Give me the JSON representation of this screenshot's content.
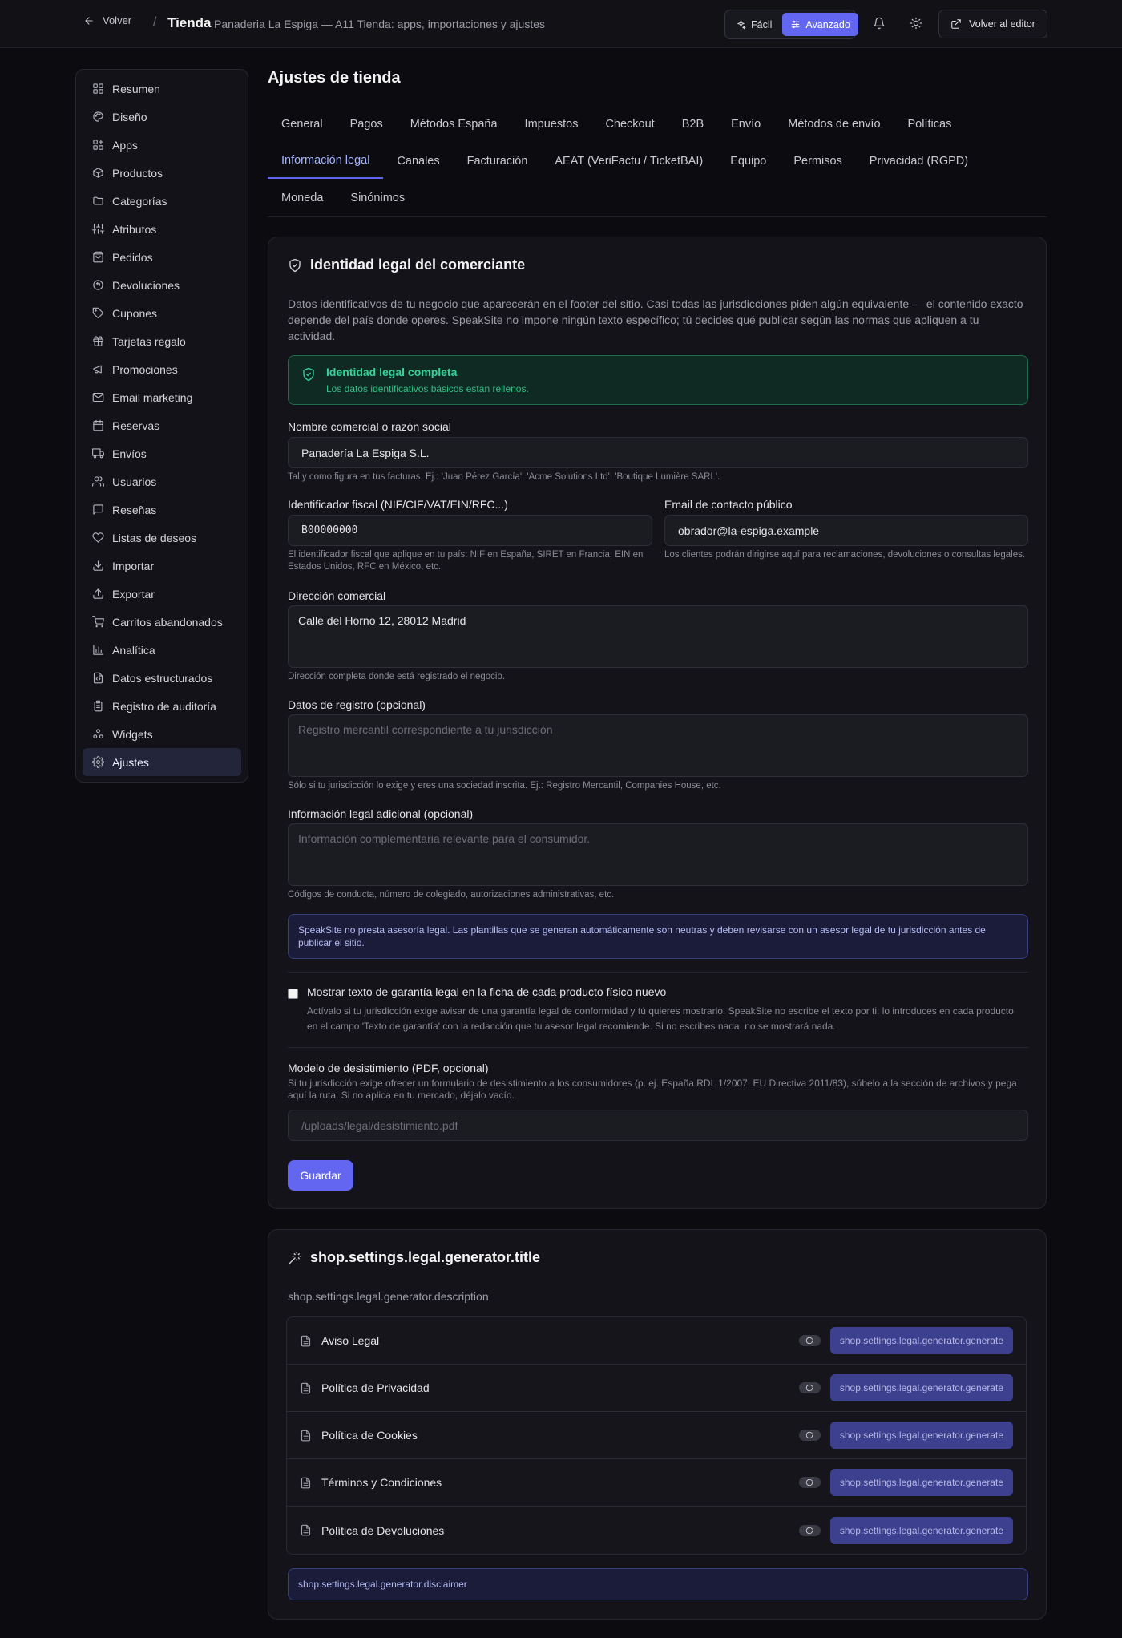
{
  "topbar": {
    "back_label": "Volver",
    "separator": "/",
    "app_title": "Tienda",
    "subtitle": "Panaderia La Espiga — A11 Tienda: apps, importaciones y ajustes",
    "mode_easy": "Fácil",
    "mode_advanced": "Avanzado",
    "editor_label": "Volver al editor",
    "accent_color": "#6366f1"
  },
  "sidebar": {
    "items": [
      {
        "label": "Resumen",
        "icon": "layout-grid-icon"
      },
      {
        "label": "Diseño",
        "icon": "palette-icon"
      },
      {
        "label": "Apps",
        "icon": "apps-icon"
      },
      {
        "label": "Productos",
        "icon": "package-icon"
      },
      {
        "label": "Categorías",
        "icon": "folder-icon"
      },
      {
        "label": "Atributos",
        "icon": "sliders-icon"
      },
      {
        "label": "Pedidos",
        "icon": "shopping-bag-icon"
      },
      {
        "label": "Devoluciones",
        "icon": "return-icon"
      },
      {
        "label": "Cupones",
        "icon": "tag-icon"
      },
      {
        "label": "Tarjetas regalo",
        "icon": "gift-icon"
      },
      {
        "label": "Promociones",
        "icon": "megaphone-icon"
      },
      {
        "label": "Email marketing",
        "icon": "mail-icon"
      },
      {
        "label": "Reservas",
        "icon": "calendar-icon"
      },
      {
        "label": "Envíos",
        "icon": "truck-icon"
      },
      {
        "label": "Usuarios",
        "icon": "users-icon"
      },
      {
        "label": "Reseñas",
        "icon": "message-icon"
      },
      {
        "label": "Listas de deseos",
        "icon": "heart-icon"
      },
      {
        "label": "Importar",
        "icon": "download-icon"
      },
      {
        "label": "Exportar",
        "icon": "upload-icon"
      },
      {
        "label": "Carritos abandonados",
        "icon": "cart-icon"
      },
      {
        "label": "Analítica",
        "icon": "bar-chart-icon"
      },
      {
        "label": "Datos estructurados",
        "icon": "file-code-icon"
      },
      {
        "label": "Registro de auditoría",
        "icon": "clipboard-icon"
      },
      {
        "label": "Widgets",
        "icon": "widgets-icon"
      },
      {
        "label": "Ajustes",
        "icon": "settings-icon"
      }
    ],
    "active": "Ajustes"
  },
  "main": {
    "title": "Ajustes de tienda",
    "tabs_row1": [
      "General",
      "Pagos",
      "Métodos España",
      "Impuestos",
      "Checkout",
      "B2B",
      "Envío",
      "Métodos de envío",
      "Políticas"
    ],
    "tabs_row2": [
      "Información legal",
      "Canales",
      "Facturación",
      "AEAT (VeriFactu / TicketBAI)",
      "Equipo",
      "Permisos",
      "Privacidad (RGPD)"
    ],
    "tabs_row3": [
      "Moneda",
      "Sinónimos"
    ],
    "active_tab": "Información legal"
  },
  "legal": {
    "title": "Identidad legal del comerciante",
    "description": "Datos identificativos de tu negocio que aparecerán en el footer del sitio. Casi todas las jurisdicciones piden algún equivalente — el contenido exacto depende del país donde operes. SpeakSite no impone ningún texto específico; tú decides qué publicar según las normas que apliquen a tu actividad.",
    "status_title": "Identidad legal completa",
    "status_sub": "Los datos identificativos básicos están rellenos.",
    "name_label": "Nombre comercial o razón social",
    "name_value": "Panadería La Espiga S.L.",
    "name_help": "Tal y como figura en tus facturas. Ej.: 'Juan Pérez García', 'Acme Solutions Ltd', 'Boutique Lumière SARL'.",
    "tax_label": "Identificador fiscal (NIF/CIF/VAT/EIN/RFC...)",
    "tax_value": "B00000000",
    "tax_help": "El identificador fiscal que aplique en tu país: NIF en España, SIRET en Francia, EIN en Estados Unidos, RFC en México, etc.",
    "email_label": "Email de contacto público",
    "email_value": "obrador@la-espiga.example",
    "email_help": "Los clientes podrán dirigirse aquí para reclamaciones, devoluciones o consultas legales.",
    "address_label": "Dirección comercial",
    "address_value": "Calle del Horno 12, 28012 Madrid",
    "address_help": "Dirección completa donde está registrado el negocio.",
    "registry_label": "Datos de registro (opcional)",
    "registry_placeholder": "Registro mercantil correspondiente a tu jurisdicción",
    "registry_help": "Sólo si tu jurisdicción lo exige y eres una sociedad inscrita. Ej.: Registro Mercantil, Companies House, etc.",
    "extra_label": "Información legal adicional (opcional)",
    "extra_placeholder": "Información complementaria relevante para el consumidor.",
    "extra_help": "Códigos de conducta, número de colegiado, autorizaciones administrativas, etc.",
    "notice": "SpeakSite no presta asesoría legal. Las plantillas que se generan automáticamente son neutras y deben revisarse con un asesor legal de tu jurisdicción antes de publicar el sitio.",
    "warranty_label": "Mostrar texto de garantía legal en la ficha de cada producto físico nuevo",
    "warranty_help": "Actívalo si tu jurisdicción exige avisar de una garantía legal de conformidad y tú quieres mostrarlo. SpeakSite no escribe el texto por ti: lo introduces en cada producto en el campo 'Texto de garantía' con la redacción que tu asesor legal recomiende. Si no escribes nada, no se mostrará nada.",
    "withdrawal_label": "Modelo de desistimiento (PDF, opcional)",
    "withdrawal_help": "Si tu jurisdicción exige ofrecer un formulario de desistimiento a los consumidores (p. ej. España RDL 1/2007, EU Directiva 2011/83), súbelo a la sección de archivos y pega aquí la ruta. Si no aplica en tu mercado, déjalo vacío.",
    "withdrawal_placeholder": "/uploads/legal/desistimiento.pdf",
    "save_label": "Guardar"
  },
  "generator": {
    "title": "shop.settings.legal.generator.title",
    "description": "shop.settings.legal.generator.description",
    "button_label": "shop.settings.legal.generator.generate",
    "docs": [
      "Aviso Legal",
      "Política de Privacidad",
      "Política de Cookies",
      "Términos y Condiciones",
      "Política de Devoluciones"
    ],
    "disclaimer": "shop.settings.legal.generator.disclaimer"
  }
}
